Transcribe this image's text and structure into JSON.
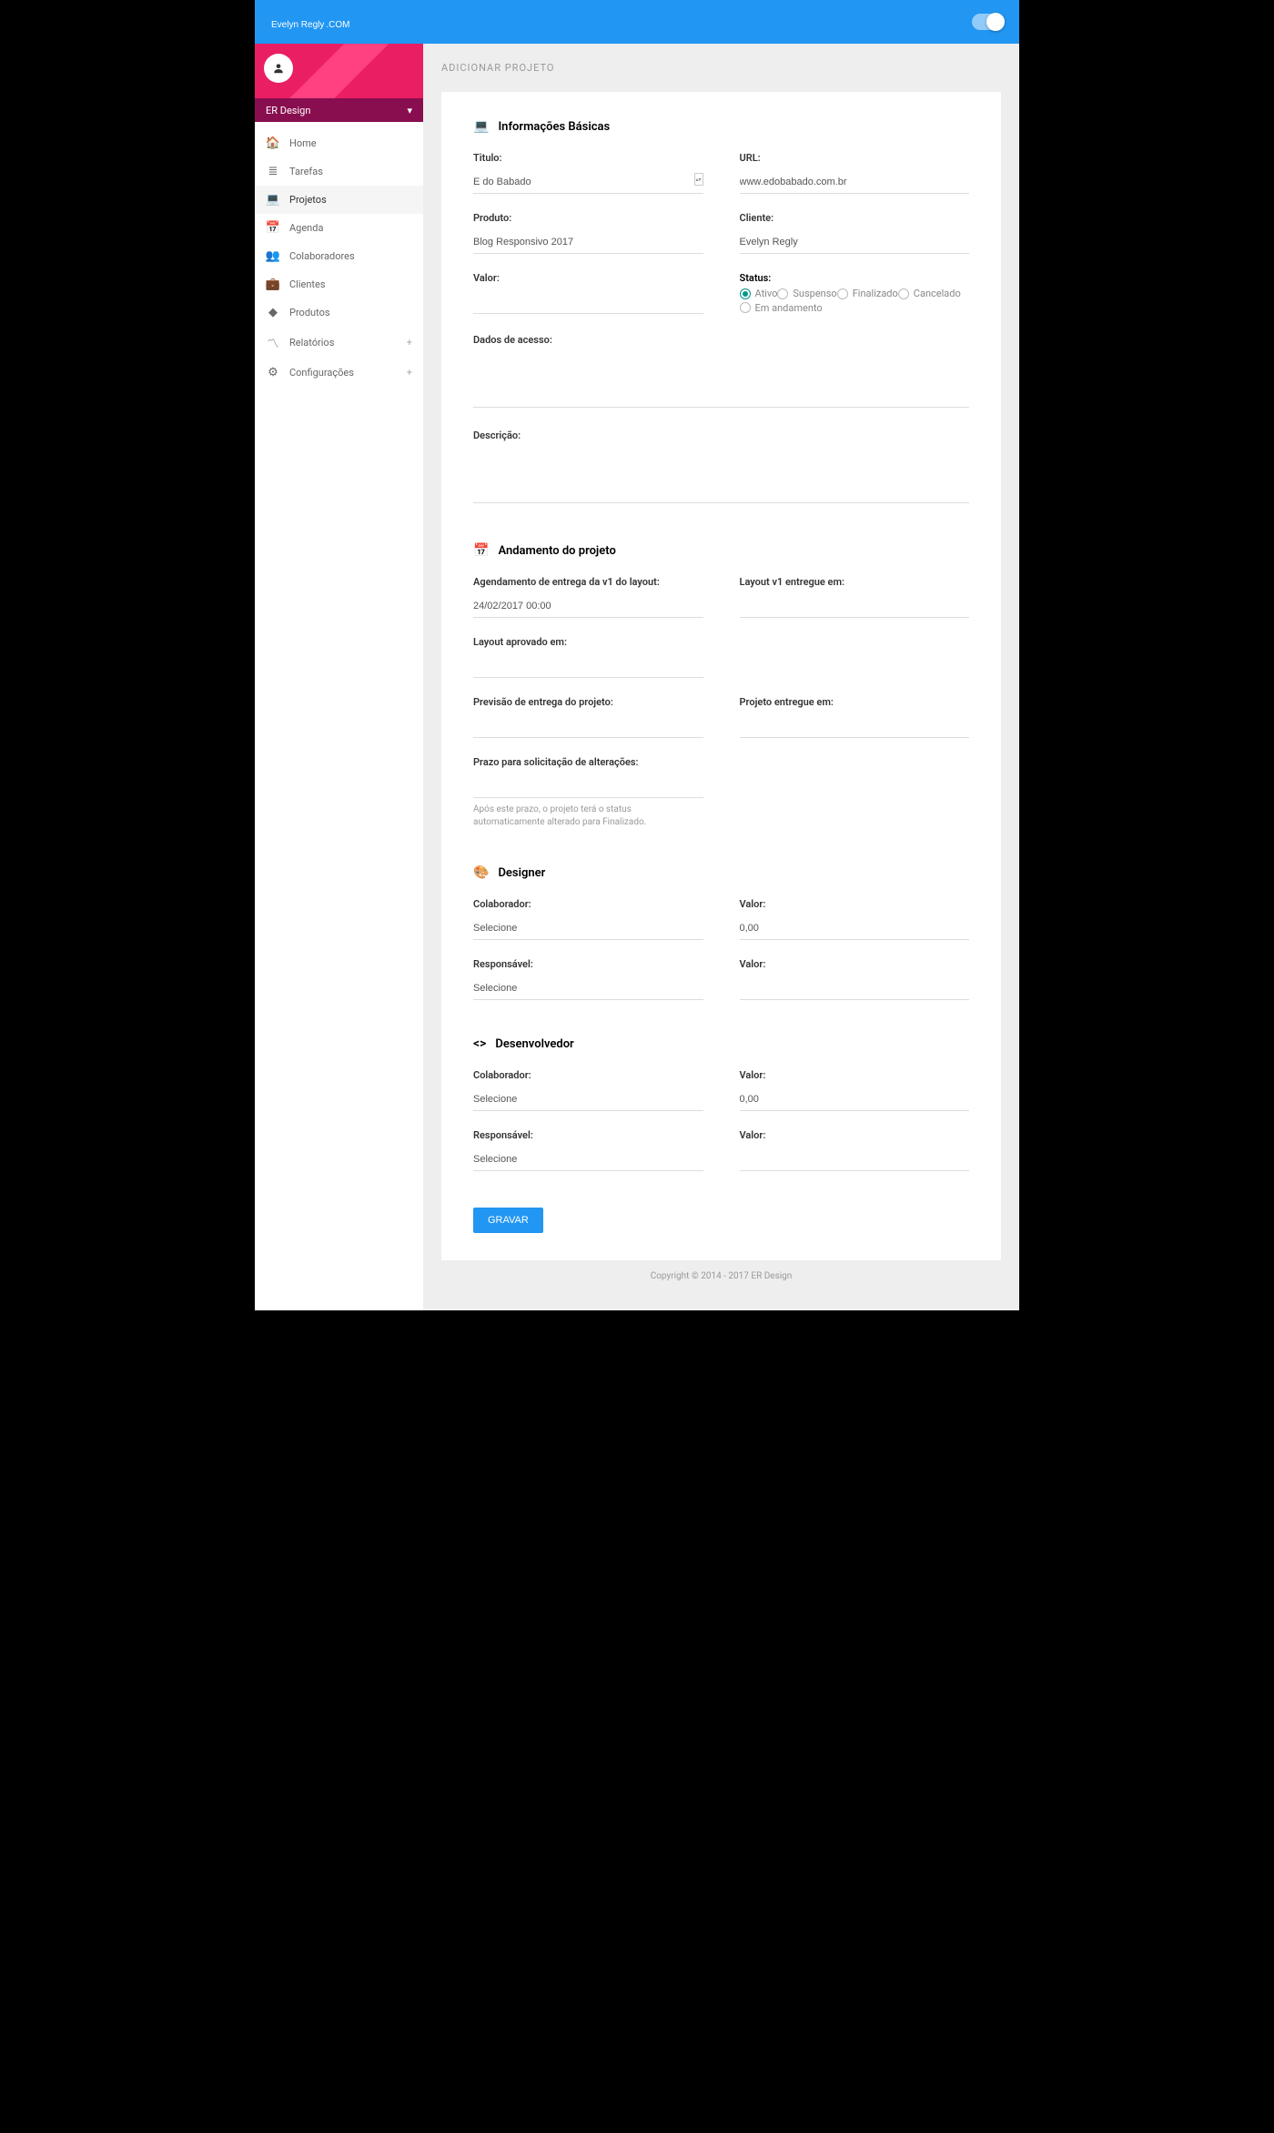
{
  "logo": {
    "name": "Evelyn Regly",
    "suffix": ".COM"
  },
  "sidebar": {
    "brand": "ER Design",
    "items": [
      {
        "icon": "🏠",
        "label": "Home",
        "name": "home"
      },
      {
        "icon": "≣",
        "label": "Tarefas",
        "name": "tarefas"
      },
      {
        "icon": "💻",
        "label": "Projetos",
        "name": "projetos",
        "active": true
      },
      {
        "icon": "📅",
        "label": "Agenda",
        "name": "agenda"
      },
      {
        "icon": "👥",
        "label": "Colaboradores",
        "name": "colaboradores"
      },
      {
        "icon": "💼",
        "label": "Clientes",
        "name": "clientes"
      },
      {
        "icon": "◆",
        "label": "Produtos",
        "name": "produtos"
      },
      {
        "icon": "〽",
        "label": "Relatórios",
        "name": "relatorios",
        "plus": true
      },
      {
        "icon": "⚙",
        "label": "Configurações",
        "name": "configuracoes",
        "plus": true
      }
    ]
  },
  "page": {
    "title": "ADICIONAR PROJETO"
  },
  "sections": {
    "basic": {
      "title": "Informações Básicas",
      "titulo": {
        "label": "Titulo:",
        "value": "E do Babado"
      },
      "url": {
        "label": "URL:",
        "value": "www.edobabado.com.br"
      },
      "produto": {
        "label": "Produto:",
        "value": "Blog Responsivo 2017"
      },
      "cliente": {
        "label": "Cliente:",
        "value": "Evelyn Regly"
      },
      "valor": {
        "label": "Valor:",
        "value": ""
      },
      "status": {
        "label": "Status:",
        "options": [
          {
            "label": "Ativo",
            "checked": true
          },
          {
            "label": "Suspenso",
            "checked": false
          },
          {
            "label": "Finalizado",
            "checked": false
          },
          {
            "label": "Cancelado",
            "checked": false
          },
          {
            "label": "Em andamento",
            "checked": false
          }
        ]
      },
      "dados": {
        "label": "Dados de acesso:",
        "value": ""
      },
      "descricao": {
        "label": "Descrição:",
        "value": ""
      }
    },
    "progress": {
      "title": "Andamento do projeto",
      "agendamento": {
        "label": "Agendamento de entrega da v1 do layout:",
        "value": "24/02/2017 00:00"
      },
      "layout_entregue": {
        "label": "Layout v1 entregue em:",
        "value": ""
      },
      "layout_aprovado": {
        "label": "Layout aprovado em:",
        "value": ""
      },
      "previsao": {
        "label": "Previsão de entrega do projeto:",
        "value": ""
      },
      "projeto_entregue": {
        "label": "Projeto entregue em:",
        "value": ""
      },
      "prazo": {
        "label": "Prazo para solicitação de alterações:",
        "value": "",
        "helper": "Após este prazo, o projeto terá o status automaticamente alterado para Finalizado."
      }
    },
    "designer": {
      "title": "Designer",
      "colaborador": {
        "label": "Colaborador:",
        "value": "Selecione"
      },
      "valor": {
        "label": "Valor:",
        "value": "0,00"
      },
      "responsavel": {
        "label": "Responsável:",
        "value": "Selecione"
      },
      "valor2": {
        "label": "Valor:",
        "value": ""
      }
    },
    "dev": {
      "title": "Desenvolvedor",
      "colaborador": {
        "label": "Colaborador:",
        "value": "Selecione"
      },
      "valor": {
        "label": "Valor:",
        "value": "0,00"
      },
      "responsavel": {
        "label": "Responsável:",
        "value": "Selecione"
      },
      "valor2": {
        "label": "Valor:",
        "value": ""
      }
    }
  },
  "button": {
    "save": "GRAVAR"
  },
  "footer": "Copyright © 2014 - 2017 ER Design"
}
